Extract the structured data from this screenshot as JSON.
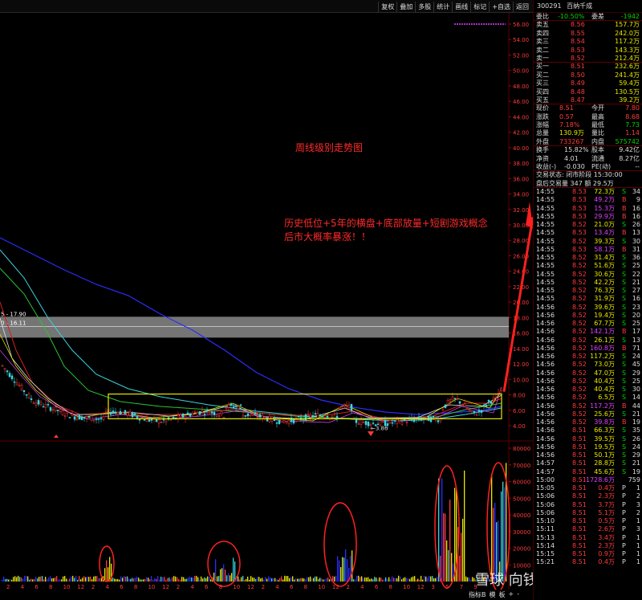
{
  "toolbar": {
    "buttons": [
      "复权",
      "叠加",
      "多股",
      "统计",
      "画线",
      "标记",
      "+自选",
      "返回"
    ]
  },
  "annotations": {
    "title": "周线级别走势图",
    "line1": "历史低位+5年的横盘+底部放量+短剧游戏概念",
    "line2": "后市大概率暴涨！！"
  },
  "price_axis": [
    "56.00",
    "54.00",
    "52.00",
    "50.00",
    "48.00",
    "46.00",
    "44.00",
    "42.00",
    "40.00",
    "38.00",
    "36.00",
    "34.00",
    "32.00",
    "30.00",
    "28.00",
    "26.00",
    "24.00",
    "22.00",
    "20.00",
    "18.00",
    "16.00",
    "14.00",
    "12.00",
    "10.00",
    "8.00",
    "6.00",
    "4.00"
  ],
  "volume_axis": [
    "80000",
    "70000",
    "60000",
    "50000",
    "40000",
    "30000",
    "20000",
    "10000"
  ],
  "band_labels": {
    "upper": "5 - 17.90",
    "lower": "0 - 16.11"
  },
  "low_marker": "3.86",
  "x_axis_labels": [
    "2",
    "4",
    "6",
    "8",
    "10",
    "12",
    "2",
    "4",
    "6",
    "8",
    "10",
    "12",
    "2",
    "4",
    "6",
    "8",
    "10",
    "12",
    "2",
    "4",
    "6",
    "8",
    "10",
    "12",
    "2",
    "4",
    "6",
    "8",
    "10",
    "12",
    "3",
    "5",
    "7",
    "9"
  ],
  "bottom_tabs": [
    "指标B",
    "模",
    "板",
    "+",
    "-"
  ],
  "watermark": "雪球 向钱看23",
  "stock": {
    "code": "300291",
    "name": "百纳千成"
  },
  "summary": {
    "weibi_label": "委比",
    "weibi": "-10.50%",
    "weicha_label": "委差",
    "weicha": "-1942"
  },
  "asks": [
    {
      "label": "卖五",
      "price": "8.56",
      "vol": "157.7万"
    },
    {
      "label": "卖四",
      "price": "8.55",
      "vol": "242.0万"
    },
    {
      "label": "卖三",
      "price": "8.54",
      "vol": "117.2万"
    },
    {
      "label": "卖二",
      "price": "8.53",
      "vol": "143.3万"
    },
    {
      "label": "卖一",
      "price": "8.52",
      "vol": "212.4万"
    }
  ],
  "bids": [
    {
      "label": "买一",
      "price": "8.51",
      "vol": "232.6万"
    },
    {
      "label": "买二",
      "price": "8.50",
      "vol": "241.4万"
    },
    {
      "label": "买三",
      "price": "8.49",
      "vol": "59.4万"
    },
    {
      "label": "买四",
      "price": "8.48",
      "vol": "130.5万"
    },
    {
      "label": "买五",
      "price": "8.47",
      "vol": "39.2万"
    }
  ],
  "quote": [
    {
      "l1": "现价",
      "v1": "8.51",
      "l2": "今开",
      "v2": "7.80"
    },
    {
      "l1": "涨跌",
      "v1": "0.57",
      "l2": "最高",
      "v2": "8.68"
    },
    {
      "l1": "涨幅",
      "v1": "7.18%",
      "l2": "最低",
      "v2": "7.73"
    },
    {
      "l1": "总量",
      "v1": "130.9万",
      "l2": "量比",
      "v2": "1.14"
    },
    {
      "l1": "外盘",
      "v1": "733267",
      "l2": "内盘",
      "v2": "575742"
    }
  ],
  "quote2": [
    {
      "l1": "换手",
      "v1": "15.82%",
      "l2": "股本",
      "v2": "9.42亿"
    },
    {
      "l1": "净资",
      "v1": "4.01",
      "l2": "流通",
      "v2": "8.27亿"
    },
    {
      "l1": "收益(-)",
      "v1": "-0.030",
      "l2": "PE(动)",
      "v2": "--"
    }
  ],
  "trade_status": "交易状态: 闭市阶段 15:30:00",
  "after_hours": "盘后交易量 347 额 29.5万",
  "ticks": [
    {
      "t": "14:55",
      "p": "8.53",
      "a": "72.3万",
      "s": "S",
      "n": "34"
    },
    {
      "t": "14:55",
      "p": "8.53",
      "a": "49.2万",
      "s": "B",
      "n": "9"
    },
    {
      "t": "14:55",
      "p": "8.53",
      "a": "15.3万",
      "s": "B",
      "n": "16"
    },
    {
      "t": "14:55",
      "p": "8.53",
      "a": "29.9万",
      "s": "B",
      "n": "16"
    },
    {
      "t": "14:55",
      "p": "8.52",
      "a": "21.0万",
      "s": "S",
      "n": "26"
    },
    {
      "t": "14:55",
      "p": "8.53",
      "a": "13.4万",
      "s": "B",
      "n": "13"
    },
    {
      "t": "14:55",
      "p": "8.52",
      "a": "39.3万",
      "s": "S",
      "n": "30"
    },
    {
      "t": "14:55",
      "p": "8.53",
      "a": "58.1万",
      "s": "B",
      "n": "31"
    },
    {
      "t": "14:55",
      "p": "8.52",
      "a": "31.4万",
      "s": "S",
      "n": "36"
    },
    {
      "t": "14:55",
      "p": "8.52",
      "a": "51.6万",
      "s": "S",
      "n": "25"
    },
    {
      "t": "14:55",
      "p": "8.52",
      "a": "30.6万",
      "s": "S",
      "n": "22"
    },
    {
      "t": "14:55",
      "p": "8.52",
      "a": "42.2万",
      "s": "S",
      "n": "21"
    },
    {
      "t": "14:55",
      "p": "8.52",
      "a": "76.3万",
      "s": "S",
      "n": "27"
    },
    {
      "t": "14:55",
      "p": "8.52",
      "a": "31.9万",
      "s": "S",
      "n": "16"
    },
    {
      "t": "14:56",
      "p": "8.52",
      "a": "39.6万",
      "s": "S",
      "n": "23"
    },
    {
      "t": "14:56",
      "p": "8.52",
      "a": "19.4万",
      "s": "S",
      "n": "20"
    },
    {
      "t": "14:56",
      "p": "8.52",
      "a": "67.7万",
      "s": "S",
      "n": "25"
    },
    {
      "t": "14:56",
      "p": "8.52",
      "a": "142.1万",
      "s": "B",
      "n": "17"
    },
    {
      "t": "14:56",
      "p": "8.52",
      "a": "26.1万",
      "s": "S",
      "n": "13"
    },
    {
      "t": "14:56",
      "p": "8.52",
      "a": "160.8万",
      "s": "B",
      "n": "71"
    },
    {
      "t": "14:56",
      "p": "8.52",
      "a": "117.2万",
      "s": "S",
      "n": "24"
    },
    {
      "t": "14:56",
      "p": "8.52",
      "a": "73.0万",
      "s": "S",
      "n": "45"
    },
    {
      "t": "14:56",
      "p": "8.52",
      "a": "47.0万",
      "s": "S",
      "n": "29"
    },
    {
      "t": "14:56",
      "p": "8.52",
      "a": "40.4万",
      "s": "S",
      "n": "25"
    },
    {
      "t": "14:56",
      "p": "8.52",
      "a": "40.4万",
      "s": "S",
      "n": "30"
    },
    {
      "t": "14:56",
      "p": "8.52",
      "a": "6.5万",
      "s": "S",
      "n": "14"
    },
    {
      "t": "14:56",
      "p": "8.52",
      "a": "117.2万",
      "s": "B",
      "n": "44"
    },
    {
      "t": "14:56",
      "p": "8.52",
      "a": "25.6万",
      "s": "S",
      "n": "21"
    },
    {
      "t": "14:56",
      "p": "8.52",
      "a": "39.8万",
      "s": "B",
      "n": "19"
    },
    {
      "t": "14:56",
      "p": "8.51",
      "a": "66.3万",
      "s": "S",
      "n": "35"
    },
    {
      "t": "14:56",
      "p": "8.51",
      "a": "39.5万",
      "s": "S",
      "n": "26"
    },
    {
      "t": "14:56",
      "p": "8.51",
      "a": "19.5万",
      "s": "S",
      "n": "24"
    },
    {
      "t": "14:56",
      "p": "8.51",
      "a": "50.1万",
      "s": "S",
      "n": "29"
    },
    {
      "t": "14:57",
      "p": "8.51",
      "a": "28.8万",
      "s": "S",
      "n": "21"
    },
    {
      "t": "14:57",
      "p": "8.51",
      "a": "45.6万",
      "s": "S",
      "n": "19"
    },
    {
      "t": "15:00",
      "p": "8.51",
      "a": "1728.6万",
      "s": "",
      "n": "759"
    },
    {
      "t": "15:05",
      "p": "8.51",
      "a": "0.4万",
      "s": "P",
      "n": "1"
    },
    {
      "t": "15:06",
      "p": "8.51",
      "a": "2.3万",
      "s": "P",
      "n": "2"
    },
    {
      "t": "15:06",
      "p": "8.51",
      "a": "3.7万",
      "s": "P",
      "n": "3"
    },
    {
      "t": "15:06",
      "p": "8.51",
      "a": "5.1万",
      "s": "P",
      "n": "2"
    },
    {
      "t": "15:10",
      "p": "8.51",
      "a": "0.5万",
      "s": "P",
      "n": "1"
    },
    {
      "t": "15:11",
      "p": "8.51",
      "a": "2.6万",
      "s": "P",
      "n": "3"
    },
    {
      "t": "15:13",
      "p": "8.51",
      "a": "3.4万",
      "s": "P",
      "n": "1"
    },
    {
      "t": "15:14",
      "p": "8.51",
      "a": "2.3万",
      "s": "P",
      "n": "1"
    },
    {
      "t": "15:15",
      "p": "8.51",
      "a": "0.9万",
      "s": "P",
      "n": "1"
    },
    {
      "t": "15:21",
      "p": "8.51",
      "a": "0.4万",
      "s": "P",
      "n": "1"
    }
  ],
  "colors": {
    "up": "#ff3b3b",
    "down": "#00d200",
    "neutral": "#e8e800",
    "annotation": "#ff2a2a",
    "band": "#8a8a8a"
  }
}
